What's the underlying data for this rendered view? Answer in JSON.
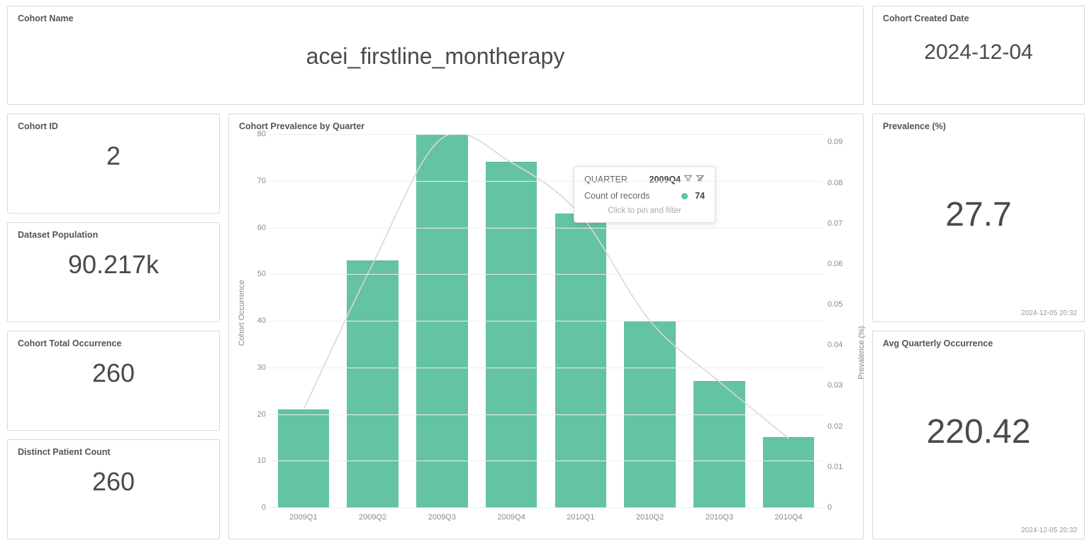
{
  "cards": {
    "cohort_name": {
      "title": "Cohort Name",
      "value": "acei_firstline_montherapy"
    },
    "created": {
      "title": "Cohort Created Date",
      "value": "2024-12-04"
    },
    "cohort_id": {
      "title": "Cohort ID",
      "value": "2"
    },
    "population": {
      "title": "Dataset Population",
      "value": "90.217k"
    },
    "total_occ": {
      "title": "Cohort Total Occurrence",
      "value": "260"
    },
    "distinct": {
      "title": "Distinct Patient Count",
      "value": "260"
    },
    "prevalence": {
      "title": "Prevalence (%)",
      "value": "27.7",
      "timestamp": "2024-12-05 20:32"
    },
    "avg_q": {
      "title": "Avg Quarterly Occurrence",
      "value": "220.42",
      "timestamp": "2024-12-05 20:32"
    }
  },
  "chart": {
    "title": "Cohort Prevalence by Quarter",
    "y_left_label": "Cohort Occurrence",
    "y_right_label": "Prevalence (%)",
    "tooltip": {
      "quarter_label": "QUARTER",
      "quarter_value": "2009Q4",
      "count_label": "Count of records",
      "count_value": "74",
      "footer": "Click to pin and filter"
    }
  },
  "chart_data": {
    "type": "bar",
    "categories": [
      "2009Q1",
      "2009Q2",
      "2009Q3",
      "2009Q4",
      "2010Q1",
      "2010Q2",
      "2010Q3",
      "2010Q4"
    ],
    "series": [
      {
        "name": "Cohort Occurrence",
        "axis": "left",
        "kind": "bar",
        "values": [
          21,
          53,
          80,
          74,
          63,
          40,
          27,
          15
        ]
      },
      {
        "name": "Prevalence (%)",
        "axis": "right",
        "kind": "line",
        "values": [
          0.024,
          0.06,
          0.091,
          0.085,
          0.072,
          0.046,
          0.031,
          0.017
        ]
      }
    ],
    "y_left": {
      "min": 0,
      "max": 80,
      "ticks": [
        0,
        10,
        20,
        30,
        40,
        50,
        60,
        70,
        80
      ]
    },
    "y_right": {
      "min": 0,
      "max": 0.092,
      "ticks": [
        0,
        0.01,
        0.02,
        0.03,
        0.04,
        0.05,
        0.06,
        0.07,
        0.08,
        0.09
      ]
    },
    "xlabel": "",
    "title": "Cohort Prevalence by Quarter"
  }
}
